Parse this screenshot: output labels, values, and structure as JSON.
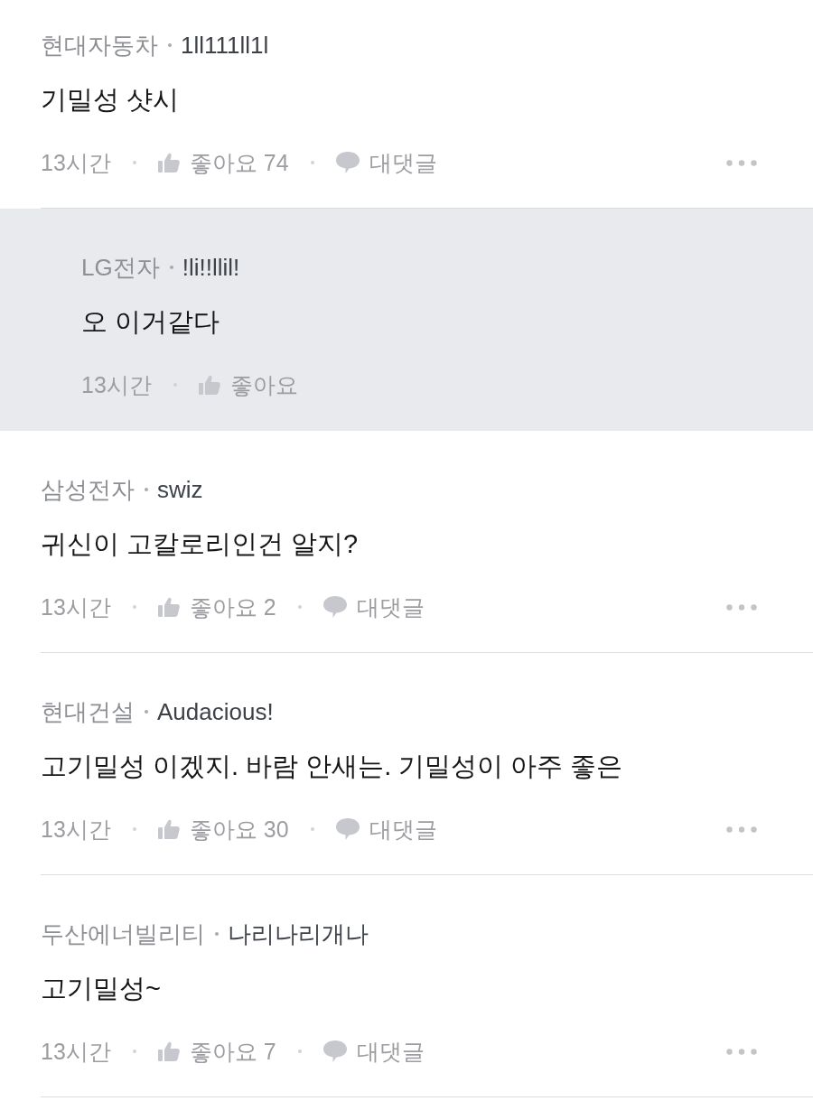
{
  "comments": [
    {
      "kind": "comment",
      "company": "현대자동차",
      "author": "1ll111ll1l",
      "text": "기밀성 샷시",
      "time": "13시간",
      "likes": "좋아요 74",
      "reply_button": "대댓글"
    },
    {
      "kind": "reply",
      "company": "LG전자",
      "author": "!li!!llil!",
      "text": "오 이거같다",
      "time": "13시간",
      "likes": "좋아요"
    },
    {
      "kind": "comment",
      "company": "삼성전자",
      "author": "swiz",
      "text": "귀신이 고칼로리인건 알지?",
      "time": "13시간",
      "likes": "좋아요 2",
      "reply_button": "대댓글"
    },
    {
      "kind": "comment",
      "company": "현대건설",
      "author": "Audacious!",
      "text": "고기밀성 이겠지. 바람 안새는. 기밀성이 아주 좋은",
      "time": "13시간",
      "likes": "좋아요 30",
      "reply_button": "대댓글"
    },
    {
      "kind": "comment",
      "company": "두산에너빌리티",
      "author": "나리나리개나",
      "text": "고기밀성~",
      "time": "13시간",
      "likes": "좋아요 7",
      "reply_button": "대댓글"
    }
  ]
}
